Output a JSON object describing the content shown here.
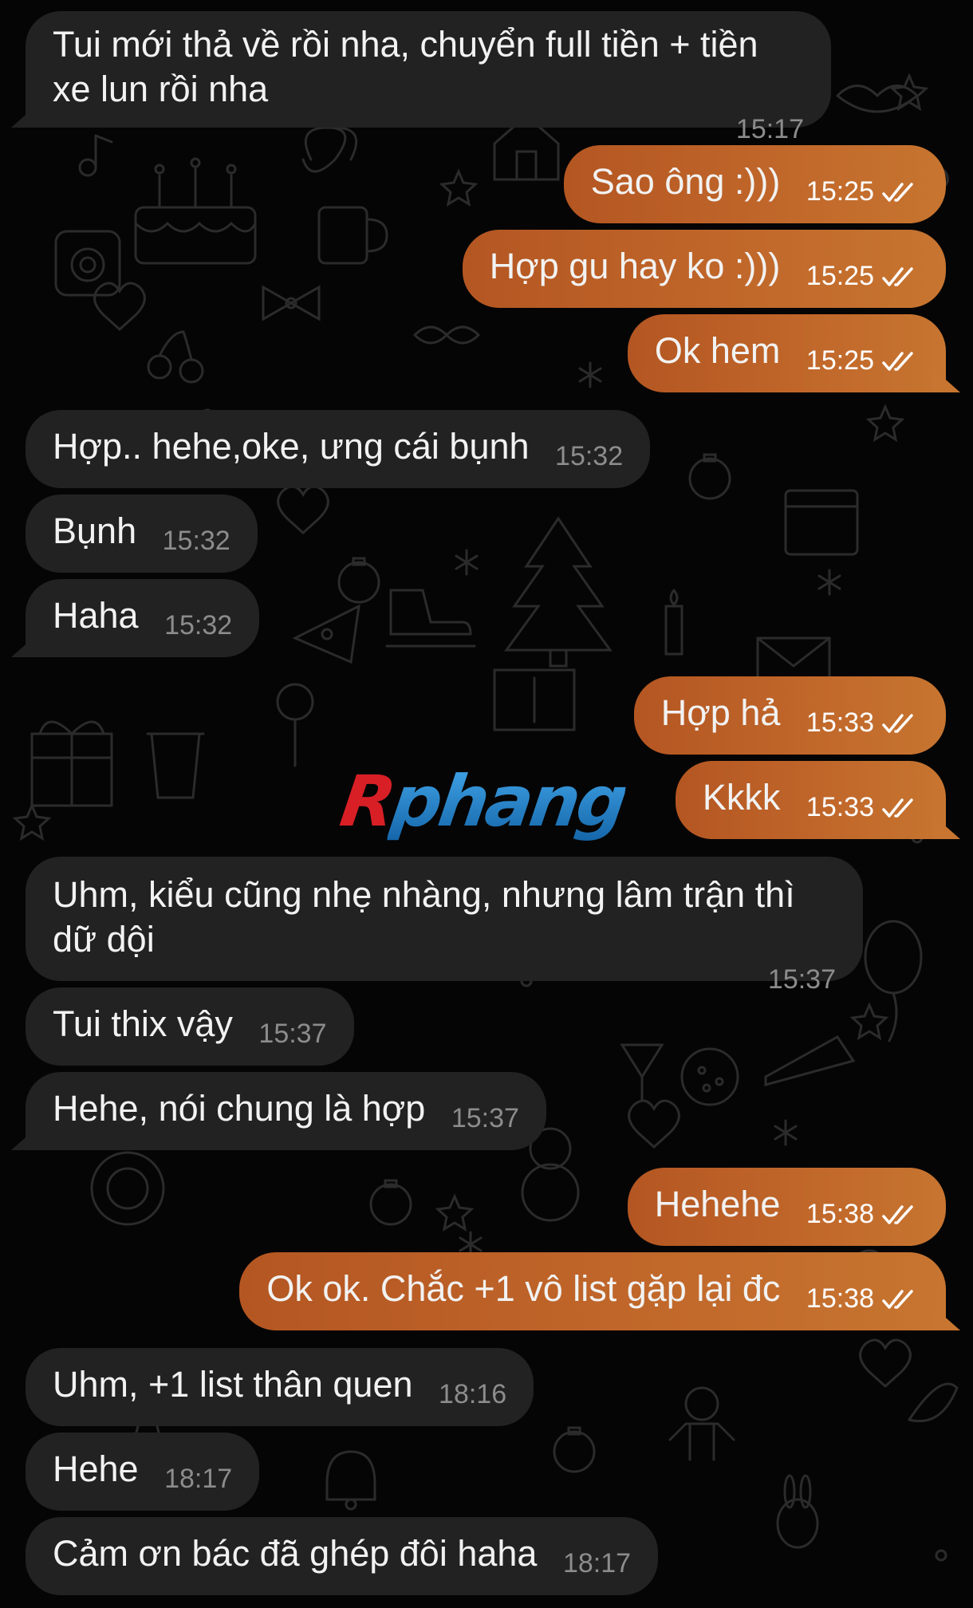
{
  "theme": {
    "incoming_bubble": "#222222",
    "outgoing_bubble_start": "#b45622",
    "outgoing_bubble_end": "#c77530",
    "background": "#050505",
    "doodle_color": "#2b2b2b",
    "incoming_time_color": "#8c8c8c",
    "outgoing_time_color": "#ffffff"
  },
  "watermark": {
    "first_letter": "R",
    "rest": "phang"
  },
  "messages": [
    {
      "dir": "in",
      "text": "Tui mới thả về rồi nha, chuyển full tiền + tiền xe lun rồi nha",
      "time": "15:17"
    },
    {
      "dir": "out",
      "text": "Sao ông :)))",
      "time": "15:25",
      "status_icon": "double-check-icon"
    },
    {
      "dir": "out",
      "text": "Hợp gu hay ko :)))",
      "time": "15:25",
      "status_icon": "double-check-icon"
    },
    {
      "dir": "out",
      "text": "Ok hem",
      "time": "15:25",
      "status_icon": "double-check-icon"
    },
    {
      "dir": "in",
      "text": "Hợp.. hehe,oke, ưng cái bụnh",
      "time": "15:32"
    },
    {
      "dir": "in",
      "text": "Bụnh",
      "time": "15:32"
    },
    {
      "dir": "in",
      "text": "Haha",
      "time": "15:32"
    },
    {
      "dir": "out",
      "text": "Hợp hả",
      "time": "15:33",
      "status_icon": "double-check-icon"
    },
    {
      "dir": "out",
      "text": "Kkkk",
      "time": "15:33",
      "status_icon": "double-check-icon"
    },
    {
      "dir": "in",
      "text": "Uhm, kiểu cũng nhẹ nhàng, nhưng lâm trận thì dữ dội",
      "time": "15:37"
    },
    {
      "dir": "in",
      "text": "Tui thix vậy",
      "time": "15:37"
    },
    {
      "dir": "in",
      "text": "Hehe, nói chung là hợp",
      "time": "15:37"
    },
    {
      "dir": "out",
      "text": "Hehehe",
      "time": "15:38",
      "status_icon": "double-check-icon"
    },
    {
      "dir": "out",
      "text": "Ok ok. Chắc +1 vô list gặp lại đc",
      "time": "15:38",
      "status_icon": "double-check-icon"
    },
    {
      "dir": "in",
      "text": "Uhm, +1 list thân quen",
      "time": "18:16"
    },
    {
      "dir": "in",
      "text": "Hehe",
      "time": "18:17"
    },
    {
      "dir": "in",
      "text": "Cảm ơn bác đã ghép đôi haha",
      "time": "18:17"
    }
  ]
}
